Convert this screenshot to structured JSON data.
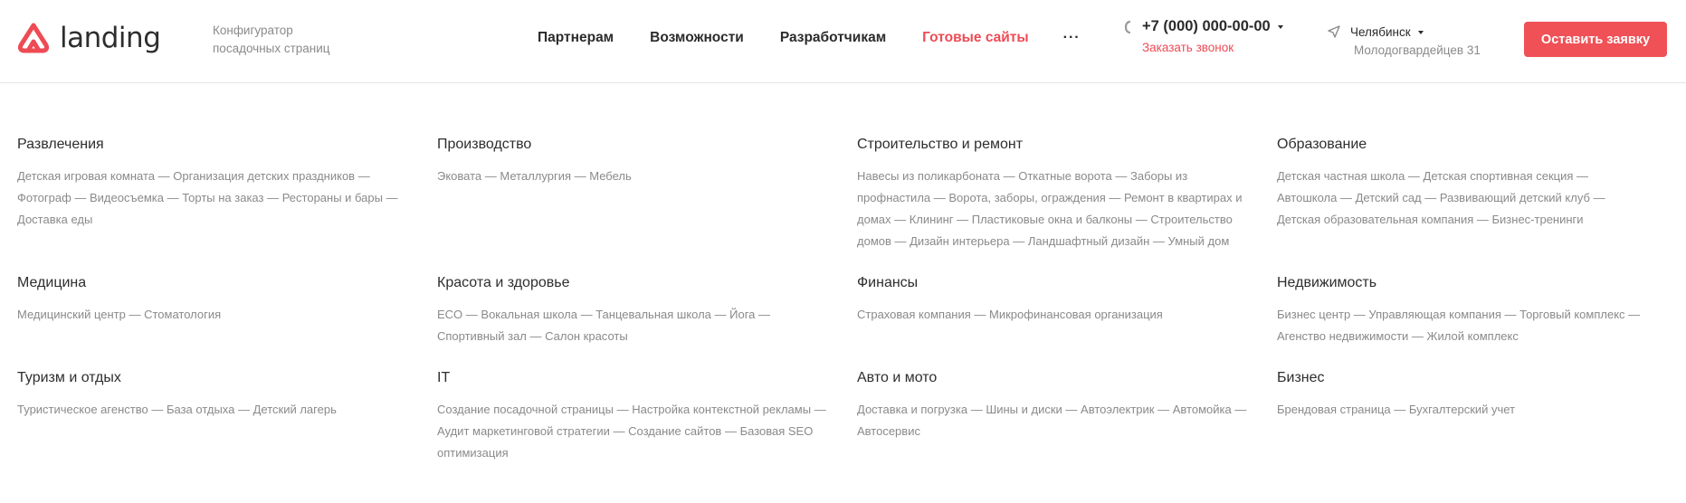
{
  "brand": {
    "name": "landing",
    "tagline_line1": "Конфигуратор",
    "tagline_line2": "посадочных страниц",
    "accent": "#ee4b55"
  },
  "nav": {
    "items": [
      {
        "label": "Партнерам"
      },
      {
        "label": "Возможности"
      },
      {
        "label": "Разработчикам"
      },
      {
        "label": "Готовые сайты"
      }
    ],
    "more": "···"
  },
  "contact": {
    "phone": "+7 (000) 000-00-00",
    "callback": "Заказать звонок"
  },
  "location": {
    "city": "Челябинск",
    "address": "Молодогвардейцев 31"
  },
  "cta": {
    "label": "Оставить заявку"
  },
  "categories": [
    {
      "title": "Развлечения",
      "links": [
        "Детская игровая комната",
        "Организация детских праздников",
        "Фотограф",
        "Видеосъемка",
        "Торты на заказ",
        "Рестораны и бары",
        "Доставка еды"
      ]
    },
    {
      "title": "Производство",
      "links": [
        "Эковата",
        "Металлургия",
        "Мебель"
      ]
    },
    {
      "title": "Строительство и ремонт",
      "links": [
        "Навесы из поликарбоната",
        "Откатные ворота",
        "Заборы из профнастила",
        "Ворота, заборы, ограждения",
        "Ремонт в квартирах и домах",
        "Клининг",
        "Пластиковые окна и балконы",
        "Строительство домов",
        "Дизайн интерьера",
        "Ландшафтный дизайн",
        "Умный дом"
      ]
    },
    {
      "title": "Образование",
      "links": [
        "Детская частная школа",
        "Детская спортивная секция",
        "Автошкола",
        "Детский сад",
        "Развивающий детский клуб",
        "Детская образовательная компания",
        "Бизнес-тренинги"
      ]
    },
    {
      "title": "Медицина",
      "links": [
        "Медицинский центр",
        "Стоматология"
      ]
    },
    {
      "title": "Красота и здоровье",
      "links": [
        "ECO",
        "Вокальная школа",
        "Танцевальная школа",
        "Йога",
        "Спортивный зал",
        "Салон красоты"
      ]
    },
    {
      "title": "Финансы",
      "links": [
        "Страховая компания",
        "Микрофинансовая организация"
      ]
    },
    {
      "title": "Недвижимость",
      "links": [
        "Бизнес центр",
        "Управляющая компания",
        "Торговый комплекс",
        "Агенство недвижимости",
        "Жилой комплекс"
      ]
    },
    {
      "title": "Туризм и отдых",
      "links": [
        "Туристическое агенство",
        "База отдыха",
        "Детский лагерь"
      ]
    },
    {
      "title": "IT",
      "links": [
        "Создание посадочной страницы",
        "Настройка контекстной рекламы",
        "Аудит маркетинговой стратегии",
        "Создание сайтов",
        "Базовая SEO оптимизация"
      ]
    },
    {
      "title": "Авто и мото",
      "links": [
        "Доставка и погрузка",
        "Шины и диски",
        "Автоэлектрик",
        "Автомойка",
        "Автосервис"
      ]
    },
    {
      "title": "Бизнес",
      "links": [
        "Брендовая страница",
        "Бухгалтерский учет"
      ]
    }
  ]
}
